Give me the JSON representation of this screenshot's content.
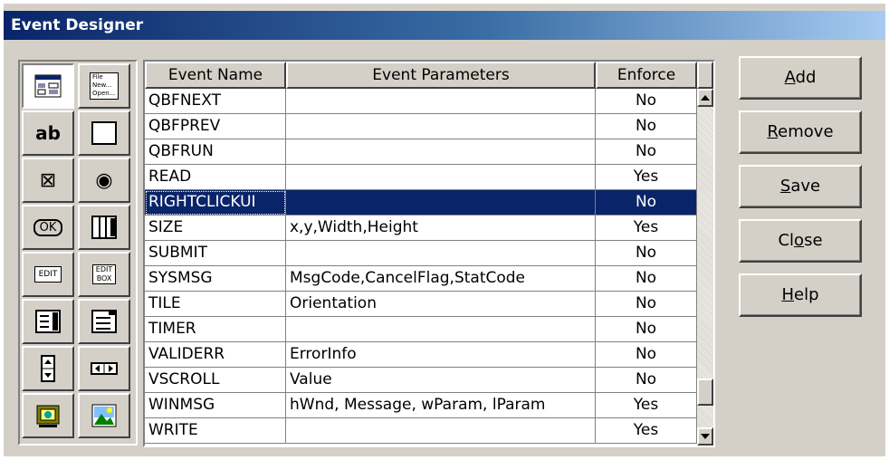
{
  "window": {
    "title": "Event Designer"
  },
  "columns": [
    "Event Name",
    "Event Parameters",
    "Enforce"
  ],
  "rows": [
    {
      "name": "QBFNEXT",
      "params": "",
      "enforce": "No"
    },
    {
      "name": "QBFPREV",
      "params": "",
      "enforce": "No"
    },
    {
      "name": "QBFRUN",
      "params": "",
      "enforce": "No"
    },
    {
      "name": "READ",
      "params": "",
      "enforce": "Yes"
    },
    {
      "name": "RIGHTCLICKUI",
      "params": "",
      "enforce": "No",
      "selected": true
    },
    {
      "name": "SIZE",
      "params": "x,y,Width,Height",
      "enforce": "Yes"
    },
    {
      "name": "SUBMIT",
      "params": "",
      "enforce": "No"
    },
    {
      "name": "SYSMSG",
      "params": "MsgCode,CancelFlag,StatCode",
      "enforce": "No"
    },
    {
      "name": "TILE",
      "params": "Orientation",
      "enforce": "No"
    },
    {
      "name": "TIMER",
      "params": "",
      "enforce": "No"
    },
    {
      "name": "VALIDERR",
      "params": "ErrorInfo",
      "enforce": "No"
    },
    {
      "name": "VSCROLL",
      "params": "Value",
      "enforce": "No"
    },
    {
      "name": "WINMSG",
      "params": "hWnd, Message, wParam, lParam",
      "enforce": "Yes"
    },
    {
      "name": "WRITE",
      "params": "",
      "enforce": "Yes"
    }
  ],
  "buttons": {
    "add": {
      "pre": "",
      "key": "A",
      "post": "dd"
    },
    "remove": {
      "pre": "",
      "key": "R",
      "post": "emove"
    },
    "save": {
      "pre": "",
      "key": "S",
      "post": "ave"
    },
    "close": {
      "pre": "Cl",
      "key": "o",
      "post": "se"
    },
    "help": {
      "pre": "",
      "key": "H",
      "post": "elp"
    }
  },
  "toolbox": {
    "items": [
      {
        "icon": "window-icon"
      },
      {
        "icon": "menu-icon",
        "text": "File New... Open..."
      },
      {
        "icon": "text-label-icon",
        "text": "ab"
      },
      {
        "icon": "frame-icon"
      },
      {
        "icon": "checkbox-icon",
        "text": "⊠"
      },
      {
        "icon": "radio-icon",
        "text": "◉"
      },
      {
        "icon": "push-button-icon",
        "text": "OK"
      },
      {
        "icon": "grid-icon"
      },
      {
        "icon": "edit-field-icon",
        "text": "EDIT"
      },
      {
        "icon": "edit-box-icon",
        "text": "EDIT BOX"
      },
      {
        "icon": "list-box-icon"
      },
      {
        "icon": "combo-box-icon"
      },
      {
        "icon": "vertical-scroll-icon"
      },
      {
        "icon": "horizontal-scroll-icon"
      },
      {
        "icon": "ole-object-icon"
      },
      {
        "icon": "picture-icon"
      }
    ]
  }
}
